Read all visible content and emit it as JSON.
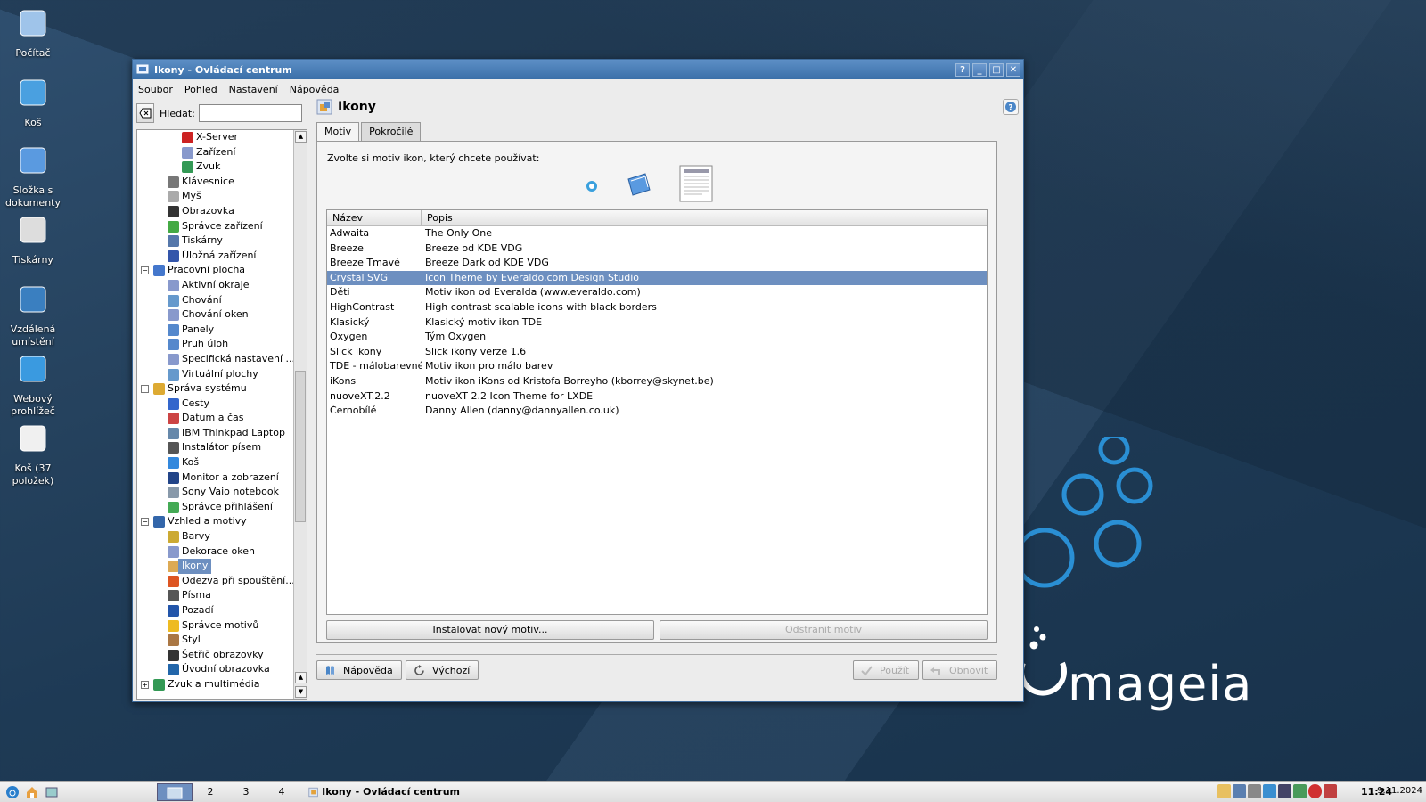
{
  "desktop": {
    "icons": [
      {
        "label": "Počítač",
        "icon": "computer-icon"
      },
      {
        "label": "Koš",
        "icon": "trash-icon"
      },
      {
        "label": "Složka s dokumenty",
        "icon": "documents-folder-icon"
      },
      {
        "label": "Tiskárny",
        "icon": "printer-icon"
      },
      {
        "label": "Vzdálená umístění",
        "icon": "network-globe-icon"
      },
      {
        "label": "Webový prohlížeč",
        "icon": "web-browser-icon"
      },
      {
        "label": "Koš (37 položek)",
        "icon": "trash-full-icon"
      }
    ],
    "brand": "mageia"
  },
  "window": {
    "title": "Ikony - Ovládací centrum",
    "menu": [
      "Soubor",
      "Pohled",
      "Nastavení",
      "Nápověda"
    ],
    "buttons": {
      "help": "?",
      "minimize": "_",
      "maximize": "□",
      "close": "✕"
    }
  },
  "sidebar": {
    "search_label": "Hledat:",
    "search_value": "",
    "tree": [
      {
        "label": "X-Server",
        "level": 2,
        "color": "#cc2222"
      },
      {
        "label": "Zařízení",
        "level": 2,
        "color": "#8899cc"
      },
      {
        "label": "Zvuk",
        "level": 2,
        "color": "#339955"
      },
      {
        "label": "Klávesnice",
        "level": 1,
        "color": "#777777"
      },
      {
        "label": "Myš",
        "level": 1,
        "color": "#aaaaaa"
      },
      {
        "label": "Obrazovka",
        "level": 1,
        "color": "#333333"
      },
      {
        "label": "Správce zařízení",
        "level": 1,
        "color": "#44aa44"
      },
      {
        "label": "Tiskárny",
        "level": 1,
        "color": "#5577aa"
      },
      {
        "label": "Úložná zařízení",
        "level": 1,
        "color": "#3355aa"
      },
      {
        "label": "Pracovní plocha",
        "level": 0,
        "color": "#4477cc",
        "expander": "−"
      },
      {
        "label": "Aktivní okraje",
        "level": 1,
        "color": "#8899cc"
      },
      {
        "label": "Chování",
        "level": 1,
        "color": "#6699cc"
      },
      {
        "label": "Chování oken",
        "level": 1,
        "color": "#8899cc"
      },
      {
        "label": "Panely",
        "level": 1,
        "color": "#5588cc"
      },
      {
        "label": "Pruh úloh",
        "level": 1,
        "color": "#5588cc"
      },
      {
        "label": "Specifická nastavení ...",
        "level": 1,
        "color": "#8899cc"
      },
      {
        "label": "Virtuální plochy",
        "level": 1,
        "color": "#6699cc"
      },
      {
        "label": "Správa systému",
        "level": 0,
        "color": "#ddaa33",
        "expander": "−"
      },
      {
        "label": "Cesty",
        "level": 1,
        "color": "#3366cc"
      },
      {
        "label": "Datum a čas",
        "level": 1,
        "color": "#cc4444"
      },
      {
        "label": "IBM Thinkpad Laptop",
        "level": 1,
        "color": "#6688aa"
      },
      {
        "label": "Instalátor písem",
        "level": 1,
        "color": "#555555"
      },
      {
        "label": "Koš",
        "level": 1,
        "color": "#3388dd"
      },
      {
        "label": "Monitor a zobrazení",
        "level": 1,
        "color": "#224488"
      },
      {
        "label": "Sony Vaio notebook",
        "level": 1,
        "color": "#8899aa"
      },
      {
        "label": "Správce přihlášení",
        "level": 1,
        "color": "#44aa55"
      },
      {
        "label": "Vzhled a motivy",
        "level": 0,
        "color": "#3366aa",
        "expander": "−"
      },
      {
        "label": "Barvy",
        "level": 1,
        "color": "#ccaa33"
      },
      {
        "label": "Dekorace oken",
        "level": 1,
        "color": "#8899cc"
      },
      {
        "label": "Ikony",
        "level": 1,
        "color": "#ddaa55",
        "selected": true
      },
      {
        "label": "Odezva při spouštění...",
        "level": 1,
        "color": "#dd5522"
      },
      {
        "label": "Písma",
        "level": 1,
        "color": "#555555"
      },
      {
        "label": "Pozadí",
        "level": 1,
        "color": "#2255aa"
      },
      {
        "label": "Správce motivů",
        "level": 1,
        "color": "#eebb22"
      },
      {
        "label": "Styl",
        "level": 1,
        "color": "#aa7744"
      },
      {
        "label": "Šetřič obrazovky",
        "level": 1,
        "color": "#333333"
      },
      {
        "label": "Úvodní obrazovka",
        "level": 1,
        "color": "#2266aa"
      },
      {
        "label": "Zvuk a multimédia",
        "level": 0,
        "color": "#339955",
        "expander": "+"
      }
    ]
  },
  "main": {
    "title": "Ikony",
    "tabs": [
      {
        "label": "Motiv",
        "active": true
      },
      {
        "label": "Pokročilé",
        "active": false
      }
    ],
    "intro": "Zvolte si motiv ikon, který chcete používat:",
    "columns": {
      "name": "Název",
      "desc": "Popis"
    },
    "themes": [
      {
        "name": "Adwaita",
        "desc": "The Only One"
      },
      {
        "name": "Breeze",
        "desc": "Breeze od KDE VDG"
      },
      {
        "name": "Breeze Tmavé",
        "desc": "Breeze Dark od KDE VDG"
      },
      {
        "name": "Crystal SVG",
        "desc": "Icon Theme by Everaldo.com Design Studio",
        "selected": true
      },
      {
        "name": "Děti",
        "desc": "Motiv ikon od Everalda (www.everaldo.com)"
      },
      {
        "name": "HighContrast",
        "desc": "High contrast scalable icons with black borders"
      },
      {
        "name": "Klasický",
        "desc": "Klasický motiv ikon TDE"
      },
      {
        "name": "Oxygen",
        "desc": "Tým Oxygen"
      },
      {
        "name": "Slick ikony",
        "desc": "Slick ikony verze 1.6"
      },
      {
        "name": "TDE - málobarevné",
        "desc": "Motiv ikon pro málo barev"
      },
      {
        "name": "iKons",
        "desc": "Motiv ikon iKons od Kristofa Borreyho (kborrey@skynet.be)"
      },
      {
        "name": "nuoveXT.2.2",
        "desc": "nuoveXT 2.2 Icon Theme for LXDE"
      },
      {
        "name": "Černobílé",
        "desc": "Danny Allen (danny@dannyallen.co.uk)"
      }
    ],
    "install_button": "Instalovat nový motiv...",
    "remove_button": "Odstranit motiv",
    "bottom_buttons": {
      "help": "Nápověda",
      "defaults": "Výchozí",
      "apply": "Použít",
      "reset": "Obnovit"
    }
  },
  "taskbar": {
    "desktops": [
      "",
      "2",
      "3",
      "4"
    ],
    "task_title": "Ikony - Ovládací centrum",
    "clock": "11:24",
    "date": "9.11.2024"
  }
}
